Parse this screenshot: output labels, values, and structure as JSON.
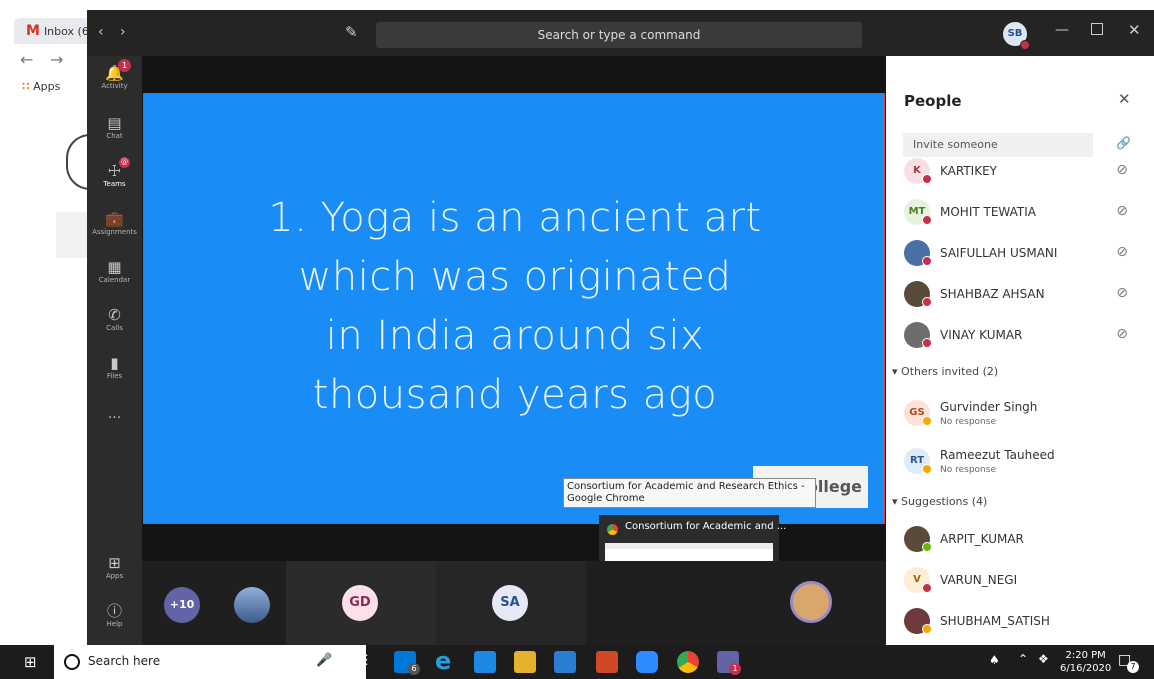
{
  "browser": {
    "tab_label": "Inbox (6",
    "bookmarks_apps": "Apps",
    "back_icon": "arrow-left",
    "forward_icon": "arrow-right"
  },
  "teams": {
    "search_placeholder": "Search or type a command",
    "user_initials": "SB",
    "rail": [
      {
        "label": "Activity",
        "badge": "1"
      },
      {
        "label": "Chat"
      },
      {
        "label": "Teams",
        "badge": "@"
      },
      {
        "label": "Assignments"
      },
      {
        "label": "Calendar"
      },
      {
        "label": "Calls"
      },
      {
        "label": "Files"
      },
      {
        "label": "..."
      },
      {
        "label": "Apps"
      },
      {
        "label": "Help"
      }
    ]
  },
  "slide": {
    "lines": [
      "1. Yoga is an ancient art",
      "which was originated",
      "in India around six",
      "thousand years ago"
    ],
    "watermark": "College"
  },
  "tooltip": "Consortium for Academic and Research Ethics - Google Chrome",
  "preview": {
    "title": "Consortium for Academic and ..."
  },
  "strip": {
    "overflow": "+10",
    "participants": [
      "GD",
      "SA"
    ]
  },
  "people_panel": {
    "title": "People",
    "invite_placeholder": "Invite someone",
    "members": [
      {
        "initials": "K",
        "name": "KARTIKEY",
        "color": "#f7e0e4",
        "fg": "#a4373a"
      },
      {
        "initials": "MT",
        "name": "MOHIT TEWATIA",
        "color": "#e7f2de",
        "fg": "#4f7a28"
      },
      {
        "initials": "",
        "name": "SAIFULLAH USMANI",
        "color": "#4a6fa5",
        "fg": "#fff"
      },
      {
        "initials": "",
        "name": "SHAHBAZ AHSAN",
        "color": "#5a4a3a",
        "fg": "#fff"
      },
      {
        "initials": "",
        "name": "VINAY KUMAR",
        "color": "#6d6d6d",
        "fg": "#fff"
      }
    ],
    "others_header": "Others invited (2)",
    "others": [
      {
        "initials": "GS",
        "name": "Gurvinder Singh",
        "sub": "No response",
        "color": "#fde3d6",
        "fg": "#b4481f"
      },
      {
        "initials": "RT",
        "name": "Rameezut Tauheed",
        "sub": "No response",
        "color": "#deecf9",
        "fg": "#2b5797"
      }
    ],
    "suggestions_header": "Suggestions (4)",
    "suggestions": [
      {
        "initials": "",
        "name": "ARPIT_KUMAR",
        "color": "#5a4a3a",
        "fg": "#fff"
      },
      {
        "initials": "V",
        "name": "VARUN_NEGI",
        "color": "#fbeed5",
        "fg": "#a0650e"
      },
      {
        "initials": "",
        "name": "SHUBHAM_SATISH",
        "color": "#6d3b3b",
        "fg": "#fff"
      }
    ]
  },
  "taskbar": {
    "search": "Search here",
    "time": "2:20 PM",
    "date": "6/16/2020",
    "mail_badge": "6",
    "teams_badge": "1",
    "notif_badge": "7"
  }
}
